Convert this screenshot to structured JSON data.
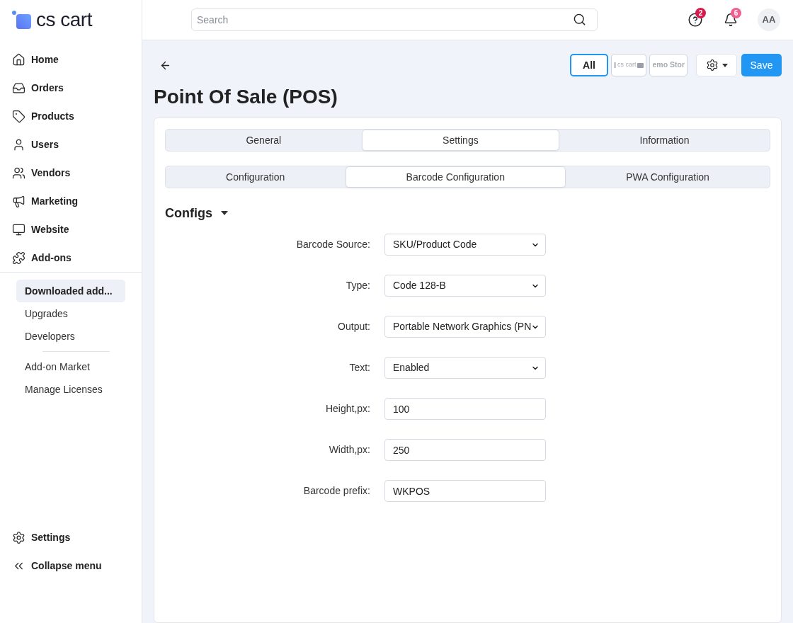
{
  "sidebar": {
    "logo": "cs cart",
    "nav": [
      {
        "label": "Home"
      },
      {
        "label": "Orders"
      },
      {
        "label": "Products"
      },
      {
        "label": "Users"
      },
      {
        "label": "Vendors"
      },
      {
        "label": "Marketing"
      },
      {
        "label": "Website"
      },
      {
        "label": "Add-ons"
      }
    ],
    "submenu_groups": [
      {
        "items": [
          {
            "label": "Downloaded add...",
            "selected": true
          },
          {
            "label": "Upgrades",
            "selected": false
          },
          {
            "label": "Developers",
            "selected": false
          }
        ]
      },
      {
        "items": [
          {
            "label": "Add-on Market",
            "selected": false
          },
          {
            "label": "Manage Licenses",
            "selected": false
          }
        ]
      }
    ],
    "footer": [
      {
        "label": "Settings"
      },
      {
        "label": "Collapse menu"
      }
    ]
  },
  "header": {
    "search": {
      "placeholder": "Search"
    },
    "icons": [
      {
        "kind": "help",
        "badge": "2",
        "color": "#d81b4f"
      },
      {
        "kind": "bell",
        "badge": "6",
        "color": "#f0608e"
      }
    ],
    "avatar": "AA"
  },
  "toolbar": {
    "stores": [
      {
        "kind": "text",
        "label": "All",
        "selected": true
      },
      {
        "kind": "logo",
        "label": "cs cart",
        "selected": false
      },
      {
        "kind": "text",
        "label": "emo Stor",
        "selected": false
      }
    ],
    "save": "Save"
  },
  "page_title": "Point Of Sale (POS)",
  "tabs": [
    {
      "label": "General",
      "selected": false
    },
    {
      "label": "Settings",
      "selected": true
    },
    {
      "label": "Information",
      "selected": false
    }
  ],
  "subtabs": [
    {
      "label": "Configuration",
      "selected": false
    },
    {
      "label": "Barcode Configuration",
      "selected": true
    },
    {
      "label": "PWA Configuration",
      "selected": false
    }
  ],
  "section": {
    "title": "Configs",
    "expanded": true
  },
  "fields": [
    {
      "label": "Barcode Source:",
      "kind": "select",
      "value": "SKU/Product Code"
    },
    {
      "label": "Type:",
      "kind": "select",
      "value": "Code 128-B"
    },
    {
      "label": "Output:",
      "kind": "select",
      "value": "Portable Network Graphics (PN"
    },
    {
      "label": "Text:",
      "kind": "select",
      "value": "Enabled"
    },
    {
      "label": "Height,px:",
      "kind": "input",
      "value": "100"
    },
    {
      "label": "Width,px:",
      "kind": "input",
      "value": "250"
    },
    {
      "label": "Barcode prefix:",
      "kind": "input",
      "value": "WKPOS"
    }
  ]
}
